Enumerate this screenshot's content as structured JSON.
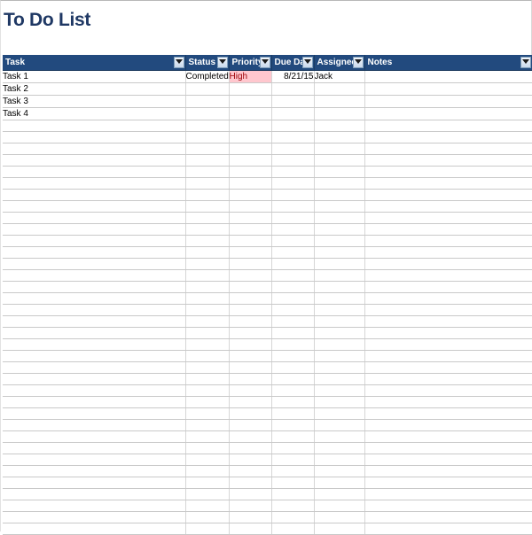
{
  "document": {
    "title": "To Do List"
  },
  "table": {
    "columns": [
      {
        "key": "task",
        "label": "Task",
        "filter_icon": "filter-dropdown-icon"
      },
      {
        "key": "status",
        "label": "Status",
        "filter_icon": "filter-dropdown-icon"
      },
      {
        "key": "priority",
        "label": "Priority",
        "filter_icon": "filter-dropdown-icon"
      },
      {
        "key": "due_date",
        "label": "Due Date",
        "filter_icon": "filter-dropdown-icon"
      },
      {
        "key": "assignee",
        "label": "Assignee",
        "filter_icon": "filter-dropdown-icon"
      },
      {
        "key": "notes",
        "label": "Notes",
        "filter_icon": "filter-dropdown-icon"
      }
    ],
    "rows": [
      {
        "task": "Task 1",
        "status": "Completed",
        "priority": "High",
        "priority_format": "high",
        "due_date": "8/21/15",
        "assignee": "Jack",
        "notes": ""
      },
      {
        "task": "Task 2",
        "status": "",
        "priority": "",
        "priority_format": "",
        "due_date": "",
        "assignee": "",
        "notes": ""
      },
      {
        "task": "Task 3",
        "status": "",
        "priority": "",
        "priority_format": "",
        "due_date": "",
        "assignee": "",
        "notes": ""
      },
      {
        "task": "Task 4",
        "status": "",
        "priority": "",
        "priority_format": "",
        "due_date": "",
        "assignee": "",
        "notes": ""
      }
    ],
    "empty_row_count": 36
  },
  "colors": {
    "title_text": "#1F3864",
    "header_background": "#224a7e",
    "header_text": "#FFFFFF",
    "gridline": "#C9C9C9",
    "priority_high_background": "#FFC7CE",
    "priority_high_text": "#9C0006",
    "sheet_background": "#FFFFFF"
  }
}
